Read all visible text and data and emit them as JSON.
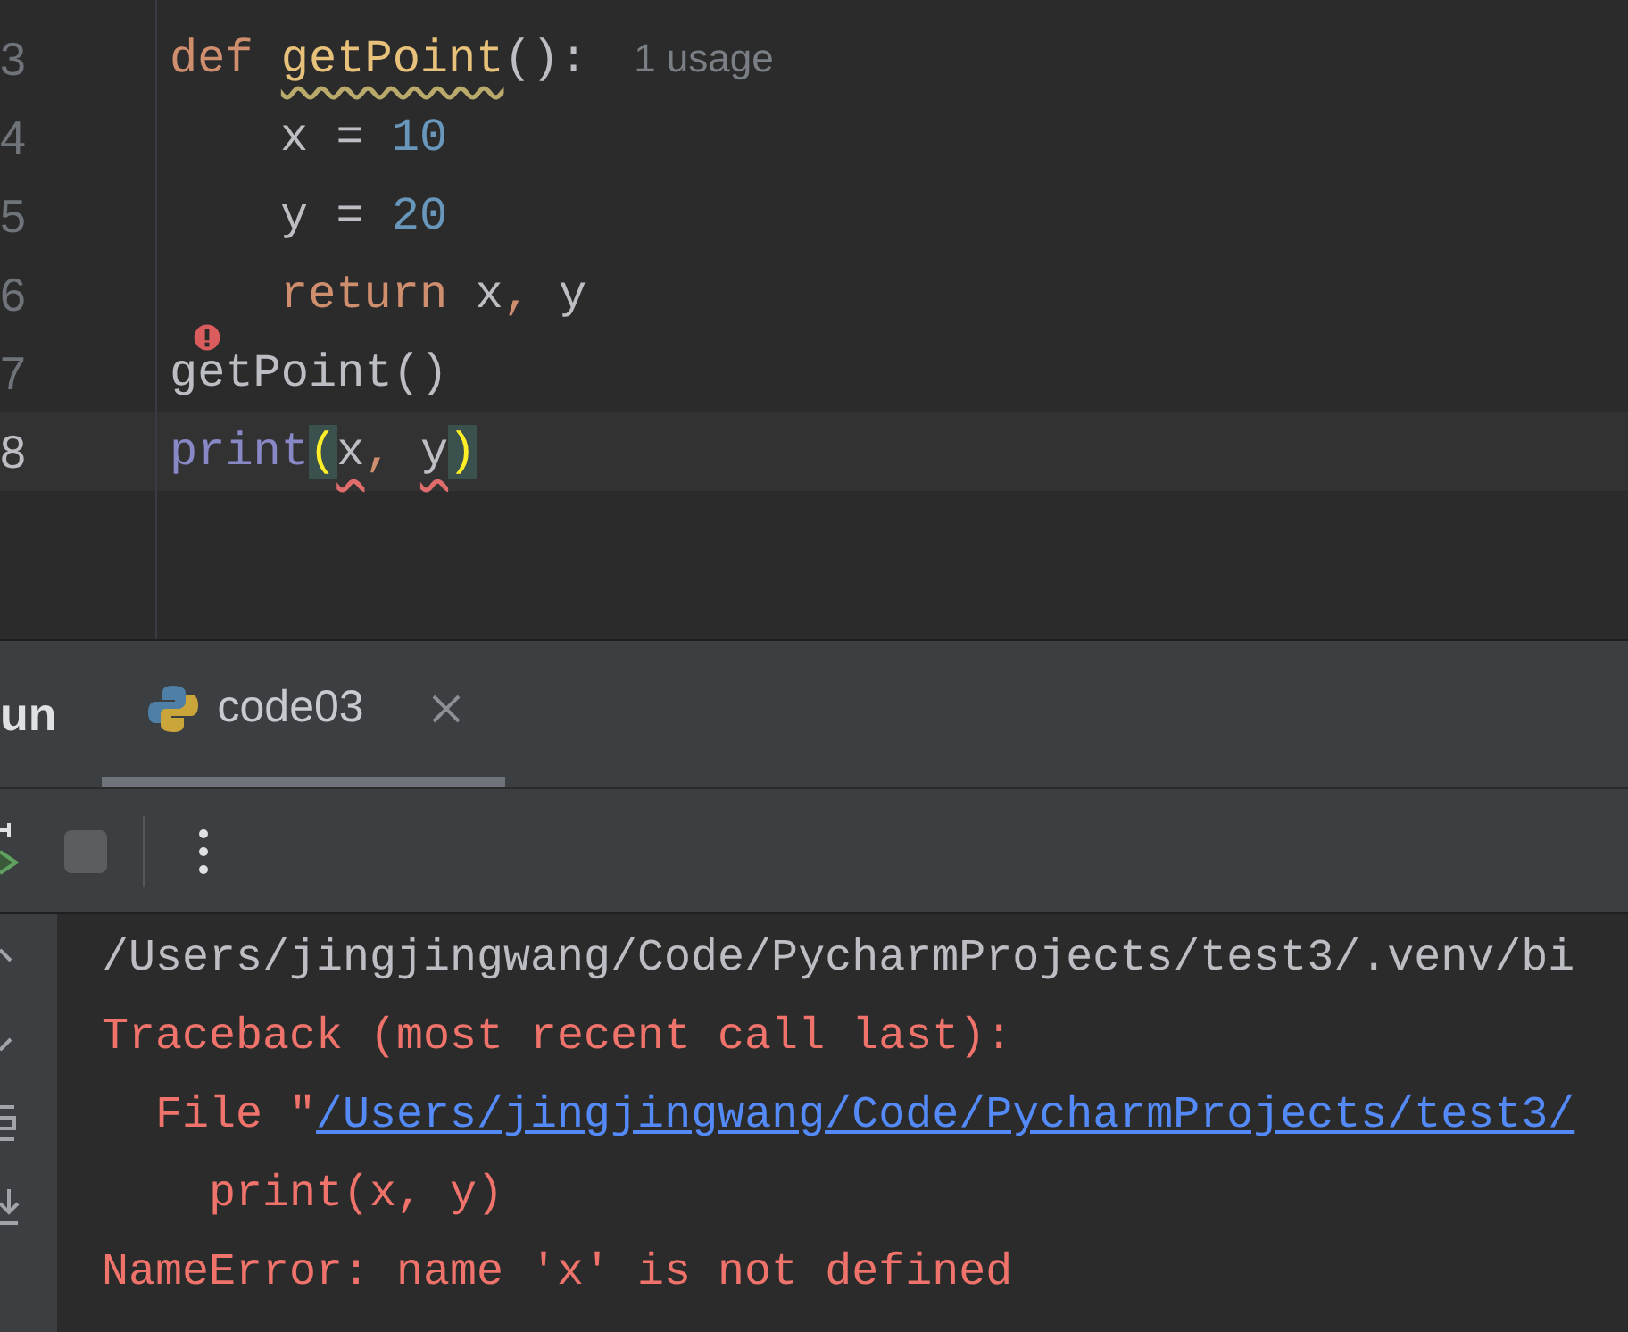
{
  "editor": {
    "lines": [
      {
        "number": "3",
        "current": false,
        "error_marker": false,
        "indented": false,
        "hint": "1 usage",
        "tokens": [
          {
            "text": "def ",
            "kind": "keyword",
            "warning": false,
            "error": false
          },
          {
            "text": "getPoint",
            "kind": "defname",
            "warning": true,
            "error": false
          },
          {
            "text": "():",
            "kind": "plain",
            "warning": false,
            "error": false
          }
        ]
      },
      {
        "number": "4",
        "current": false,
        "error_marker": false,
        "indented": true,
        "tokens": [
          {
            "text": "x = ",
            "kind": "plain",
            "warning": false,
            "error": false
          },
          {
            "text": "10",
            "kind": "number",
            "warning": false,
            "error": false
          }
        ]
      },
      {
        "number": "5",
        "current": false,
        "error_marker": false,
        "indented": true,
        "tokens": [
          {
            "text": "y = ",
            "kind": "plain",
            "warning": false,
            "error": false
          },
          {
            "text": "20",
            "kind": "number",
            "warning": false,
            "error": false
          }
        ]
      },
      {
        "number": "6",
        "current": false,
        "error_marker": false,
        "indented": true,
        "tokens": [
          {
            "text": "return",
            "kind": "keyword",
            "warning": false,
            "error": false
          },
          {
            "text": " x",
            "kind": "plain",
            "warning": false,
            "error": false
          },
          {
            "text": ",",
            "kind": "keyword",
            "warning": false,
            "error": false
          },
          {
            "text": " y",
            "kind": "plain",
            "warning": false,
            "error": false
          }
        ]
      },
      {
        "number": "7",
        "current": false,
        "error_marker": true,
        "indented": false,
        "tokens": [
          {
            "text": "getPoint()",
            "kind": "plain",
            "warning": false,
            "error": false
          }
        ]
      },
      {
        "number": "8",
        "current": true,
        "error_marker": false,
        "indented": false,
        "tokens": [
          {
            "text": "print",
            "kind": "builtin",
            "warning": false,
            "error": false
          },
          {
            "text": "(",
            "kind": "brace",
            "warning": false,
            "error": false
          },
          {
            "text": "x",
            "kind": "plain",
            "warning": false,
            "error": true
          },
          {
            "text": ", ",
            "kind": "keyword",
            "warning": false,
            "error": false
          },
          {
            "text": "y",
            "kind": "plain",
            "warning": false,
            "error": true
          },
          {
            "text": ")",
            "kind": "brace",
            "warning": false,
            "error": false
          }
        ]
      }
    ]
  },
  "run_panel": {
    "title": "un",
    "tabs": [
      {
        "label": "code03",
        "selected": true
      }
    ],
    "console": [
      {
        "text": "/Users/jingjingwang/Code/PycharmProjects/test3/.venv/bi",
        "kind": "command"
      },
      {
        "text": "Traceback (most recent call last):",
        "kind": "error"
      },
      {
        "prefix": "  File \"",
        "text": "/Users/jingjingwang/Code/PycharmProjects/test3/",
        "kind": "link"
      },
      {
        "text": "    print(x, y)",
        "kind": "error"
      },
      {
        "text": "NameError: name 'x' is not defined",
        "kind": "error"
      }
    ]
  }
}
